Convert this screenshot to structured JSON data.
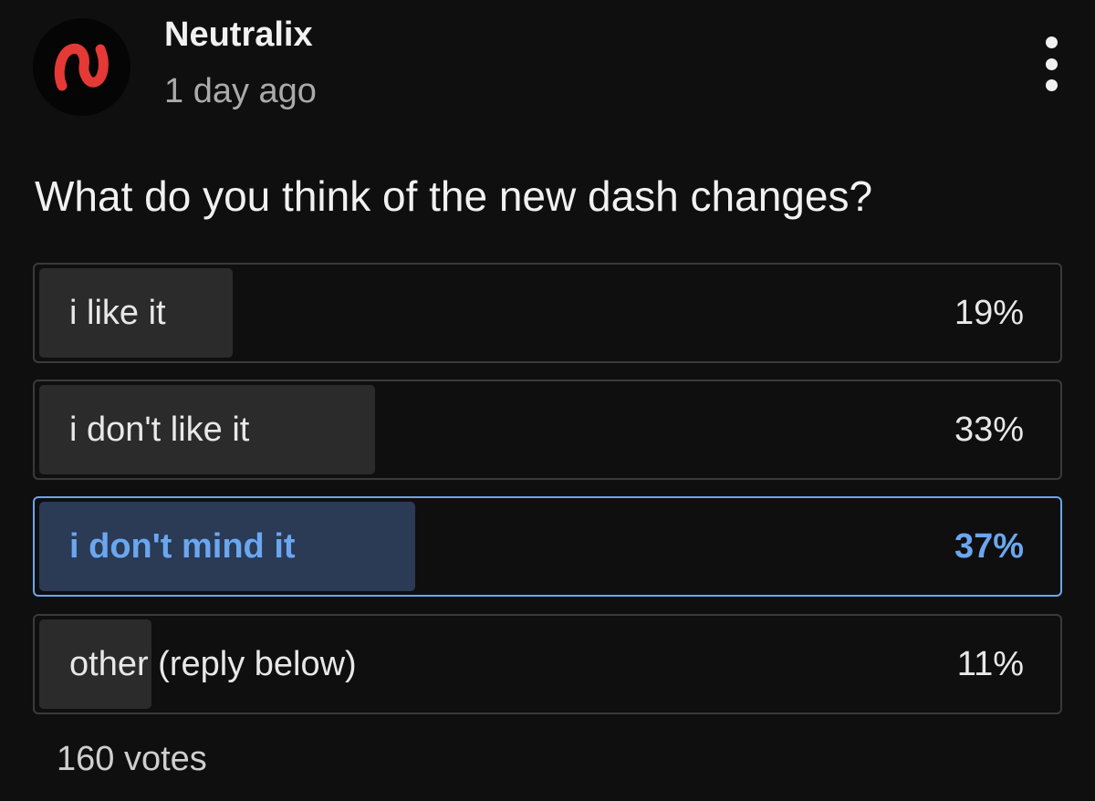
{
  "post": {
    "author": "Neutralix",
    "time": "1 day ago",
    "avatar_icon": "neutralix-logo-icon",
    "menu_icon": "more-vertical-icon"
  },
  "poll": {
    "question": "What do you think of the new dash changes?",
    "options": [
      {
        "label": "i like it",
        "percent_text": "19%",
        "percent": 19,
        "selected": false
      },
      {
        "label": "i don't like it",
        "percent_text": "33%",
        "percent": 33,
        "selected": false
      },
      {
        "label": "i don't mind it",
        "percent_text": "37%",
        "percent": 37,
        "selected": true
      },
      {
        "label": "other (reply below)",
        "percent_text": "11%",
        "percent": 11,
        "selected": false
      }
    ],
    "votes": "160 votes"
  },
  "colors": {
    "background": "#0f0f0f",
    "accent": "#6aa7f0",
    "logo_red": "#e53935"
  }
}
